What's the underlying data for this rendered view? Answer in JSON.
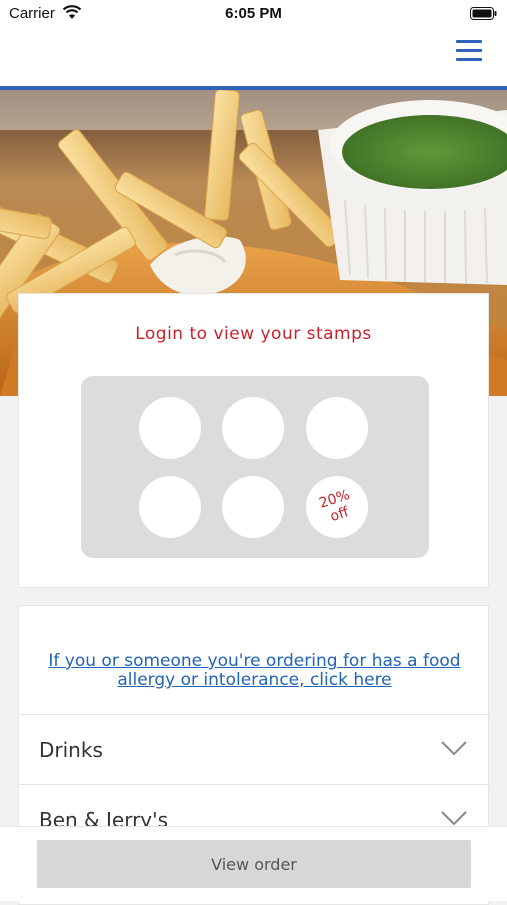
{
  "status_bar": {
    "carrier": "Carrier",
    "time": "6:05 PM"
  },
  "nav": {
    "menu_icon": "hamburger-menu-icon",
    "accent_color": "#2f62b8"
  },
  "hero": {
    "image": "fish-and-chips-with-mushy-peas"
  },
  "stamp_card": {
    "title": "Login to view your stamps",
    "stamps_collected": 0,
    "stamps_total": 6,
    "reward_line1": "20%",
    "reward_line2": "off",
    "title_color": "#c9222b"
  },
  "menu": {
    "allergy_link": "If you or someone you're ordering for has a food allergy or intolerance, click here",
    "categories": [
      {
        "label": "Drinks"
      },
      {
        "label": "Ben & Jerry's"
      }
    ]
  },
  "footer": {
    "view_order_label": "View order"
  }
}
